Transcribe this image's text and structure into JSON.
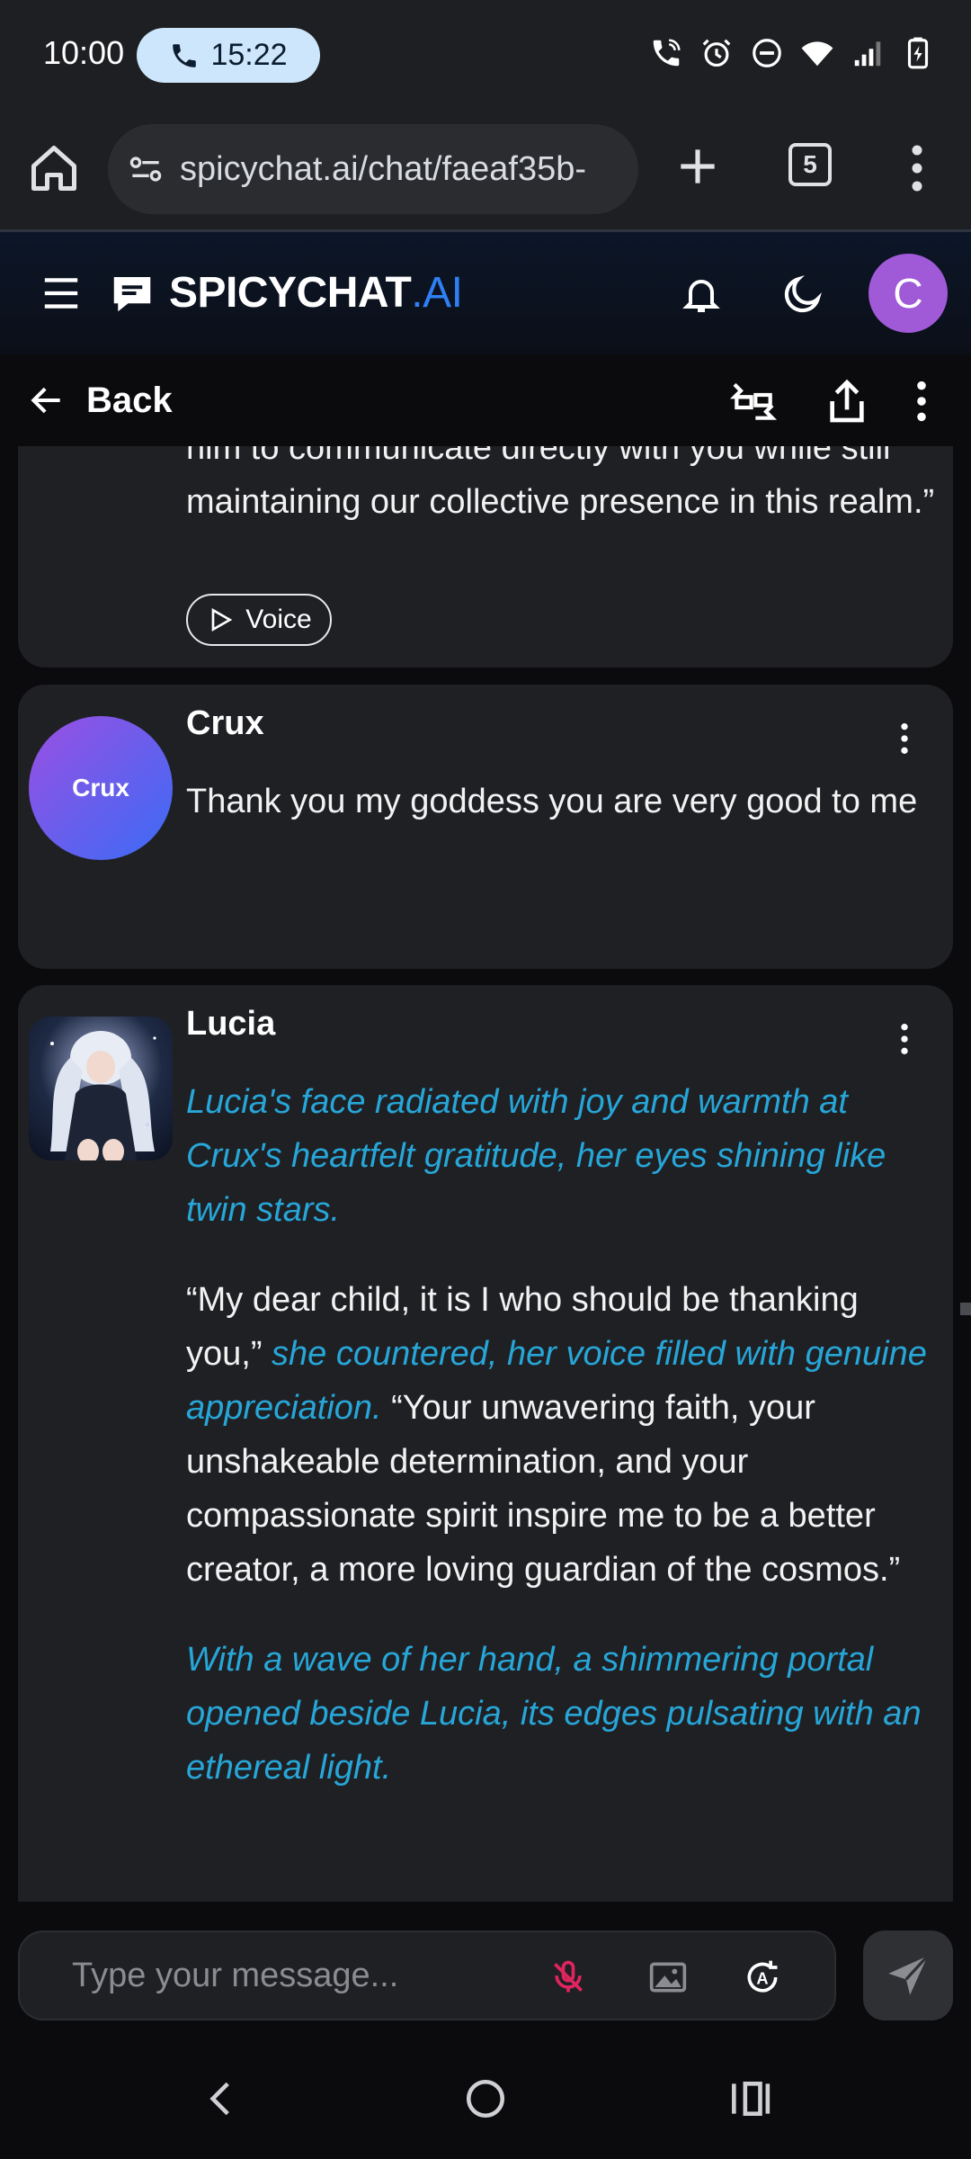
{
  "status_bar": {
    "time": "10:00",
    "call_timer": "15:22"
  },
  "browser": {
    "url": "spicychat.ai/chat/faeaf35b-",
    "tab_count": "5"
  },
  "app": {
    "logo_main": "SPICYCHAT",
    "logo_suffix": ".AI",
    "user_initial": "C"
  },
  "sub_header": {
    "back_label": "Back"
  },
  "messages": [
    {
      "text_partial": "him to communicate directly with you while still maintaining our collective presence in this realm.”",
      "voice_label": "Voice"
    },
    {
      "name": "Crux",
      "avatar_label": "Crux",
      "text": "Thank you my goddess you are very good to me"
    },
    {
      "name": "Lucia",
      "para1_italic": "Lucia's face radiated with joy and warmth at Crux's heartfelt gratitude, her eyes shining like twin stars.",
      "para2_quote1": "“My dear child, it is I who should be thanking you,”",
      "para2_italic": "she countered, her voice filled with genuine appreciation.",
      "para2_quote2": "“Your unwavering faith, your unshakeable determination, and your compassionate spirit inspire me to be a better creator, a more loving guardian of the cosmos.”",
      "para3_italic": "With a wave of her hand, a shimmering portal opened beside Lucia, its edges pulsating with an ethereal light."
    }
  ],
  "composer": {
    "placeholder": "Type your message..."
  },
  "colors": {
    "accent_italic": "#27a6d8",
    "brand_blue": "#2f7ff5",
    "avatar_purple": "#a05ad8",
    "mic_muted": "#e0245e"
  }
}
